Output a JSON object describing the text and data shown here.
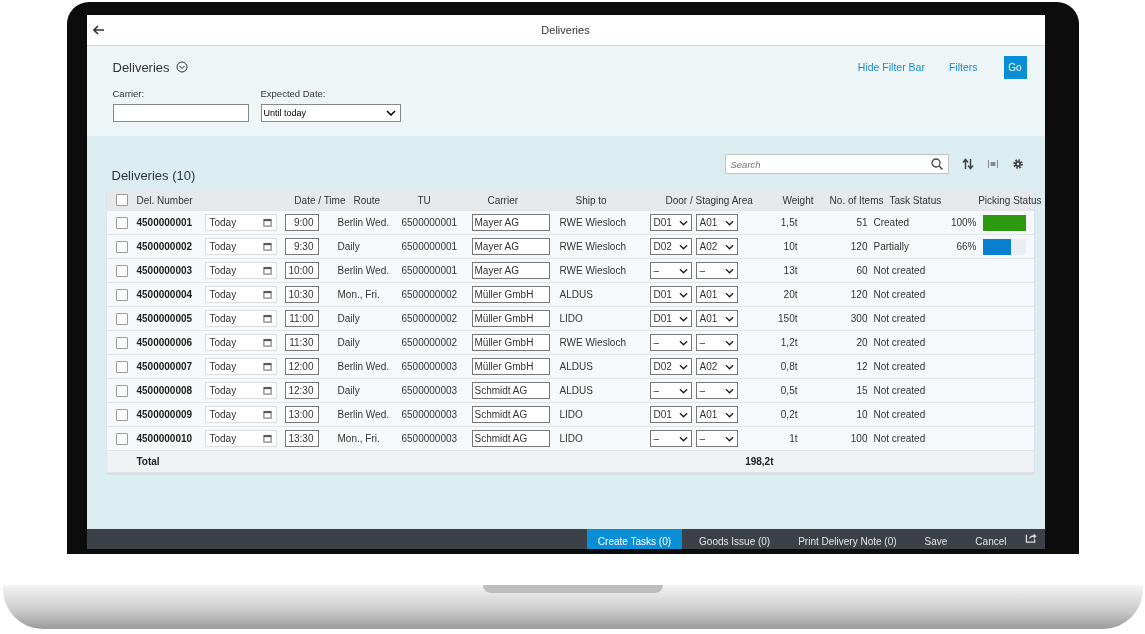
{
  "window": {
    "title": "Deliveries"
  },
  "filter_bar": {
    "title": "Deliveries",
    "hide_filter_bar": "Hide Filter Bar",
    "filters": "Filters",
    "go": "Go",
    "fields": [
      {
        "label": "Carrier:",
        "kind": "input"
      },
      {
        "label": "Expected Date:",
        "kind": "select",
        "value": "Until today"
      }
    ]
  },
  "table": {
    "title": "Deliveries (10)",
    "select_all": {
      "checked": false
    },
    "search": {
      "placeholder": "Search"
    },
    "columns": [
      "Del. Number",
      "Date / Time",
      "Route",
      "TU",
      "Carrier",
      "Ship to",
      "Door / Staging Area",
      "Weight",
      "No. of  Items",
      "Task Status",
      "Picking Status"
    ],
    "rows": [
      {
        "checked": false,
        "number": "4500000001",
        "date": "Today",
        "time": "9:00",
        "route": "Berlin Wed.",
        "tu": "6500000001",
        "carrier": "Mayer AG",
        "ship_to": "RWE Wiesloch",
        "door": "D01",
        "area": "A01",
        "weight": "1,5t",
        "items": "51",
        "task_status": "Created",
        "picking": {
          "reading": "100%",
          "level": 1,
          "color": "#2b9a0f"
        }
      },
      {
        "checked": false,
        "number": "4500000002",
        "date": "Today",
        "time": "9:30",
        "route": "Daily",
        "tu": "6500000001",
        "carrier": "Mayer AG",
        "ship_to": "RWE Wiesloch",
        "door": "D02",
        "area": "A02",
        "weight": "10t",
        "items": "120",
        "task_status": "Partially",
        "picking": {
          "reading": "66%",
          "level": 0.66,
          "color": "#0a7fd0"
        }
      },
      {
        "checked": false,
        "number": "4500000003",
        "date": "Today",
        "time": "10:00",
        "route": "Berlin Wed.",
        "tu": "6500000001",
        "carrier": "Mayer AG",
        "ship_to": "RWE Wiesloch",
        "door": "–",
        "area": "–",
        "weight": "13t",
        "items": "60",
        "task_status": "Not created"
      },
      {
        "checked": false,
        "number": "4500000004",
        "date": "Today",
        "time": "10:30",
        "route": "Mon., Fri.",
        "tu": "6500000002",
        "carrier": "Müller GmbH",
        "ship_to": "ALDUS",
        "door": "D01",
        "area": "A01",
        "weight": "20t",
        "items": "120",
        "task_status": "Not created"
      },
      {
        "checked": false,
        "number": "4500000005",
        "date": "Today",
        "time": "11:00",
        "route": "Daily",
        "tu": "6500000002",
        "carrier": "Müller GmbH",
        "ship_to": "LIDO",
        "door": "D01",
        "area": "A01",
        "weight": "150t",
        "items": "300",
        "task_status": "Not created"
      },
      {
        "checked": false,
        "number": "4500000006",
        "date": "Today",
        "time": "11:30",
        "route": "Daily",
        "tu": "6500000002",
        "carrier": "Müller GmbH",
        "ship_to": "RWE Wiesloch",
        "door": "–",
        "area": "–",
        "weight": "1,2t",
        "items": "20",
        "task_status": "Not created"
      },
      {
        "checked": false,
        "number": "4500000007",
        "date": "Today",
        "time": "12:00",
        "route": "Berlin Wed.",
        "tu": "6500000003",
        "carrier": "Müller GmbH",
        "ship_to": "ALDUS",
        "door": "D02",
        "area": "A02",
        "weight": "0,8t",
        "items": "12",
        "task_status": "Not created"
      },
      {
        "checked": false,
        "number": "4500000008",
        "date": "Today",
        "time": "12:30",
        "route": "Daily",
        "tu": "6500000003",
        "carrier": "Schmidt AG",
        "ship_to": "ALDUS",
        "door": "–",
        "area": "–",
        "weight": "0,5t",
        "items": "15",
        "task_status": "Not created"
      },
      {
        "checked": false,
        "number": "4500000009",
        "date": "Today",
        "time": "13:00",
        "route": "Berlin Wed.",
        "tu": "6500000003",
        "carrier": "Schmidt AG",
        "ship_to": "LIDO",
        "door": "D01",
        "area": "A01",
        "weight": "0,2t",
        "items": "10",
        "task_status": "Not created"
      },
      {
        "checked": false,
        "number": "4500000010",
        "date": "Today",
        "time": "13:30",
        "route": "Mon., Fri.",
        "tu": "6500000003",
        "carrier": "Schmidt AG",
        "ship_to": "LIDO",
        "door": "–",
        "area": "–",
        "weight": "1t",
        "items": "100",
        "task_status": "Not created"
      }
    ],
    "total": {
      "label": "Total",
      "weight": "198,2t"
    }
  },
  "footer": {
    "buttons": [
      {
        "label": "Create Tasks (0)",
        "kind": "primary"
      },
      {
        "label": "Goods Issue (0)",
        "kind": "plain"
      },
      {
        "label": "Print Delivery Note (0)",
        "kind": "plain"
      },
      {
        "label": "Save",
        "kind": "plain"
      },
      {
        "label": "Cancel",
        "kind": "plain"
      }
    ]
  }
}
